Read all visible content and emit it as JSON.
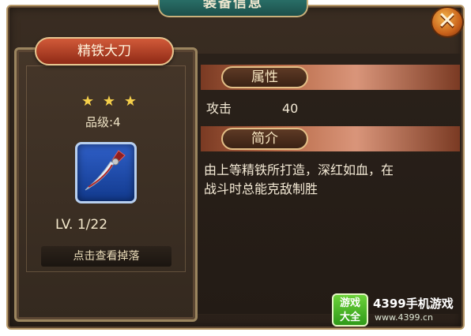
{
  "window": {
    "title": "装备信息",
    "close_label": "✕"
  },
  "item": {
    "name": "精铁大刀",
    "stars": [
      "★",
      "★",
      "★"
    ],
    "quality": "品级:4",
    "level": "LV. 1/22",
    "drop_button": "点击查看掉落",
    "icon": "blade-icon"
  },
  "attributes": {
    "header": "属性",
    "stats": [
      {
        "label": "攻击",
        "value": "40"
      }
    ]
  },
  "intro": {
    "header": "简介",
    "lines": [
      "由上等精铁所打造，深红如血，在",
      "战斗时总能克敌制胜"
    ]
  },
  "watermark": {
    "badge_line1": "游戏",
    "badge_line2": "大全",
    "name": "4399手机游戏",
    "url": "www.4399.cn"
  },
  "colors": {
    "frame": "#b99b6b",
    "section_bar": "#b86a47",
    "name_plate": "#d15a39",
    "item_bg": "#2f5fc7",
    "star": "#f5cf4a"
  }
}
